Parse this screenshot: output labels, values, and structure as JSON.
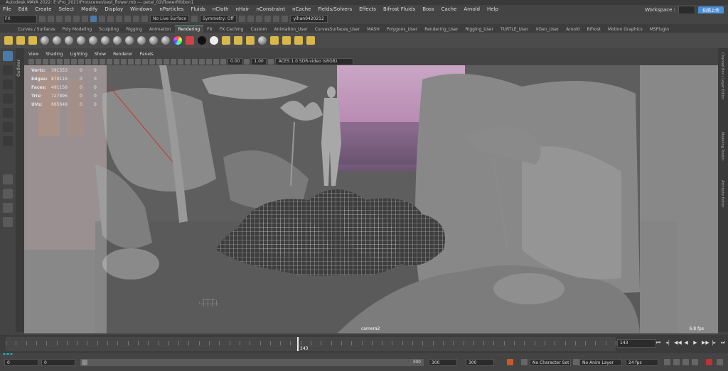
{
  "window": {
    "title": "Autodesk MAYA 2022: E:\\Pro_2021\\Pro\\scenes\\test_flower.mb --- petal_02\\flowerRibbon1"
  },
  "menubar": [
    "File",
    "Edit",
    "Create",
    "Select",
    "Modify",
    "Display",
    "Windows",
    "nParticles",
    "Fluids",
    "nCloth",
    "nHair",
    "nConstraint",
    "nCache",
    "Fields/Solvers",
    "Effects",
    "Bifrost Fluids",
    "Boss",
    "Cache",
    "Arnold",
    "Help"
  ],
  "workspace": {
    "label": "Workspace :",
    "cloud_button": "拍照上传"
  },
  "statusline": {
    "mode": "FX",
    "live_surface": "No Live Surface",
    "symmetry": "Symmetry: Off",
    "user": "yihan0420212"
  },
  "shelf_tabs": [
    "Curves / Surfaces",
    "Poly Modeling",
    "Sculpting",
    "Rigging",
    "Animation",
    "Rendering",
    "FX",
    "FX Caching",
    "Custom",
    "Animation_User",
    "CurvesSurfaces_User",
    "MASH",
    "Polygons_User",
    "Rendering_User",
    "Rigging_User",
    "TURTLE_User",
    "XGen_User",
    "Arnold",
    "Bifrost",
    "Motion Graphics",
    "MSPlugin"
  ],
  "active_shelf_tab": "Rendering",
  "shelf_icons": [
    "light-icon",
    "sphere-icon",
    "sphere-icon",
    "sphere-icon",
    "sphere-icon",
    "sphere-icon",
    "sphere-icon",
    "sphere-icon",
    "sphere-icon",
    "sphere-icon",
    "sphere-icon",
    "sphere-icon",
    "sphere-icon",
    "sphere-icon",
    "color-wheel-icon",
    "red-icon",
    "black-sphere-icon",
    "white-sphere-icon",
    "render-icon",
    "render-icon",
    "render-icon",
    "render-icon",
    "render-icon",
    "render-icon",
    "render-icon",
    "render-icon"
  ],
  "outliner_label": "Outliner",
  "panel_menu": [
    "View",
    "Shading",
    "Lighting",
    "Show",
    "Renderer",
    "Panels"
  ],
  "panel_toolbar": {
    "exposure": "0.00",
    "gamma": "1.00",
    "color_space": "ACES 1.0 SDR-video (sRGB)"
  },
  "hud": [
    {
      "label": "Verts:",
      "value": "391553",
      "a": "0",
      "b": "0"
    },
    {
      "label": "Edges:",
      "value": "879116",
      "a": "0",
      "b": "0"
    },
    {
      "label": "Faces:",
      "value": "491158",
      "a": "0",
      "b": "0"
    },
    {
      "label": "Tris:",
      "value": "727896",
      "a": "0",
      "b": "0"
    },
    {
      "label": "UVs:",
      "value": "665649",
      "a": "0",
      "b": "0"
    }
  ],
  "camera": "camera2",
  "fps": "6.8 fps",
  "right_strip": [
    "Channel Box / Layer Editor",
    "Modeling Toolkit",
    "Attribute Editor"
  ],
  "timeline": {
    "current_frame": "143",
    "current_field": "143"
  },
  "range": {
    "start": "0",
    "start2": "0",
    "end_slider": "300",
    "end": "300",
    "end2": "300",
    "character_set": "No Character Set",
    "anim_layer": "No Anim Layer",
    "fps": "24 fps"
  },
  "playback": [
    "⏮",
    "◂|",
    "◀◀",
    "◀",
    "▶",
    "▶▶",
    "|▸",
    "⏭"
  ]
}
